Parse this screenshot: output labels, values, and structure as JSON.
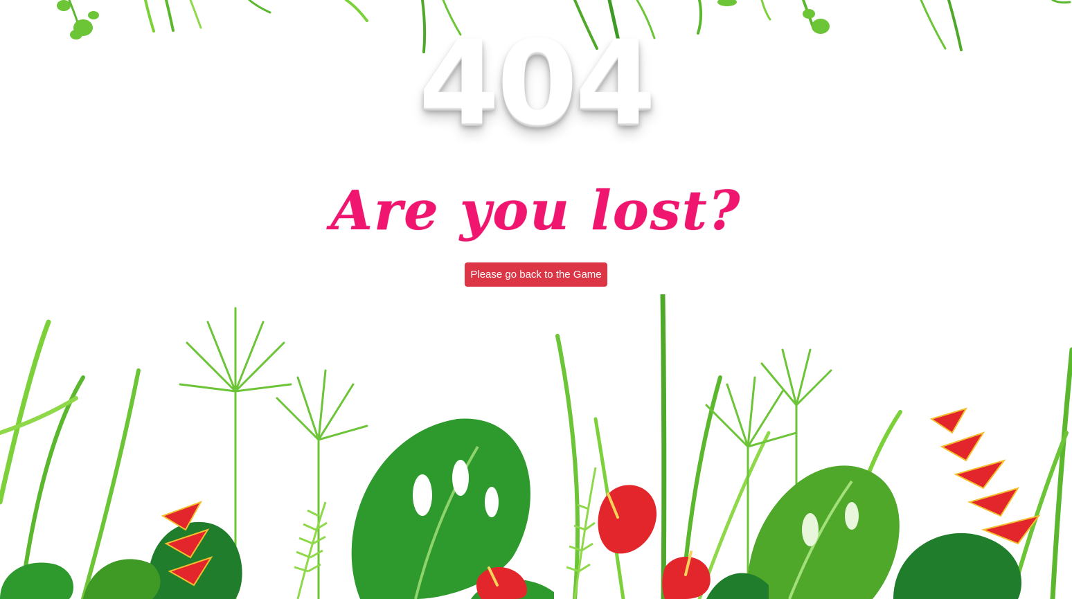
{
  "error": {
    "code": "404",
    "headline": "Are you lost?"
  },
  "actions": {
    "back_button_label": "Please go back to the Game"
  },
  "colors": {
    "headline": "#f0156e",
    "button": "#dc3545",
    "leaf_dark": "#2e9a2e",
    "leaf_light": "#7cd13a",
    "flower_red": "#e3262b"
  }
}
